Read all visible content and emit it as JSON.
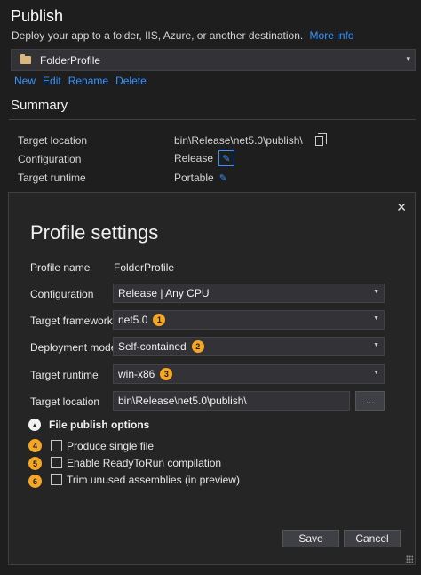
{
  "publish": {
    "title": "Publish",
    "subtitle": "Deploy your app to a folder, IIS, Azure, or another destination.",
    "more_info_link": "More info",
    "profile_selected": "FolderProfile",
    "profile_icon": "folder-icon",
    "actions": [
      "New",
      "Edit",
      "Rename",
      "Delete"
    ]
  },
  "summary": {
    "title": "Summary",
    "rows": [
      {
        "label": "Target location",
        "value": "bin\\Release\\net5.0\\publish\\",
        "icon": "copy-icon"
      },
      {
        "label": "Configuration",
        "value": "Release",
        "icon": "pencil-icon"
      },
      {
        "label": "Target runtime",
        "value": "Portable",
        "icon": "pencil-icon"
      }
    ]
  },
  "dialog": {
    "title": "Profile settings",
    "close_label": "✕",
    "profile_name_label": "Profile name",
    "profile_name_value": "FolderProfile",
    "configuration_label": "Configuration",
    "configuration_value": "Release | Any CPU",
    "framework_label": "Target framework",
    "framework_value": "net5.0",
    "framework_badge": "1",
    "deployment_label": "Deployment mode",
    "deployment_value": "Self-contained",
    "deployment_badge": "2",
    "runtime_label": "Target runtime",
    "runtime_value": "win-x86",
    "runtime_badge": "3",
    "location_label": "Target location",
    "location_value": "bin\\Release\\net5.0\\publish\\",
    "browse_label": "...",
    "file_publish_options_label": "File publish options",
    "options": [
      {
        "badge": "4",
        "label": "Produce single file",
        "checked": false
      },
      {
        "badge": "5",
        "label": "Enable ReadyToRun compilation",
        "checked": false
      },
      {
        "badge": "6",
        "label": "Trim unused assemblies (in preview)",
        "checked": false
      }
    ],
    "save_label": "Save",
    "cancel_label": "Cancel"
  },
  "colors": {
    "background": "#1e1e1e",
    "dialog": "#252526",
    "link": "#3794ff",
    "badge": "#f5a623"
  }
}
